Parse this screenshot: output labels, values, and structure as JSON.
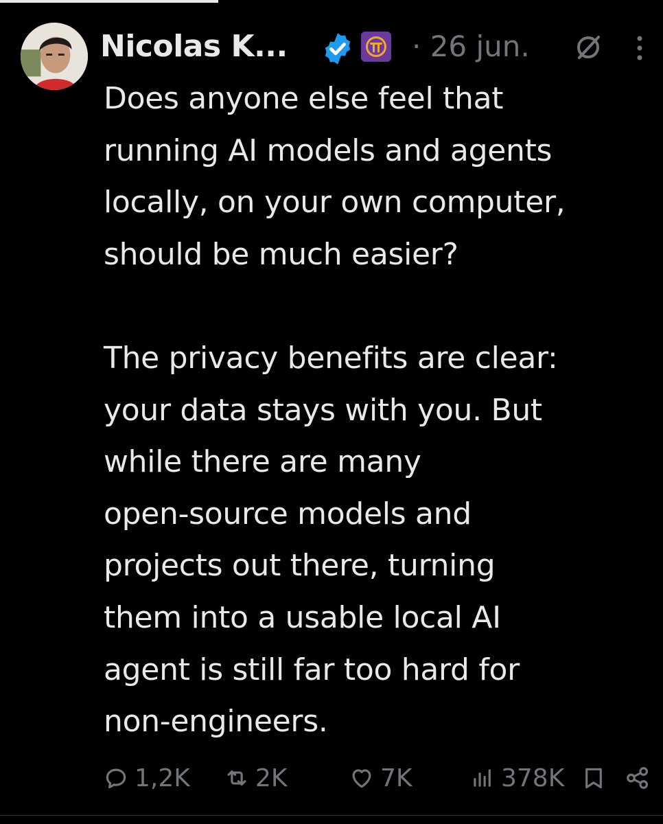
{
  "author": {
    "name": "Nicolas K...",
    "avatar_icon": "profile-photo",
    "verified_icon": "verified-badge-icon",
    "verified_color": "#1d9bf0",
    "affiliate_icon": "pi-badge-icon",
    "affiliate_color": "#6c3a9e"
  },
  "meta": {
    "date": "· 26 jun.",
    "muted_icon": "muted-circle-slash-icon",
    "more_icon": "more-dots-icon"
  },
  "tweet": {
    "text": "Does anyone else feel that\nrunning AI models and agents\nlocally, on your own computer,\nshould be much easier?\n\nThe privacy benefits are clear:\nyour data stays with you. But\nwhile there are many\nopen-source models and\nprojects out there, turning\nthem into a usable local AI\nagent is still far too hard for\nnon-engineers."
  },
  "actions": {
    "replies": "1,2K",
    "retweets": "2K",
    "likes": "7K",
    "views": "378K",
    "reply_icon": "reply-icon",
    "retweet_icon": "retweet-icon",
    "like_icon": "heart-icon",
    "views_icon": "views-bar-icon",
    "bookmark_icon": "bookmark-icon",
    "share_icon": "share-icon"
  }
}
